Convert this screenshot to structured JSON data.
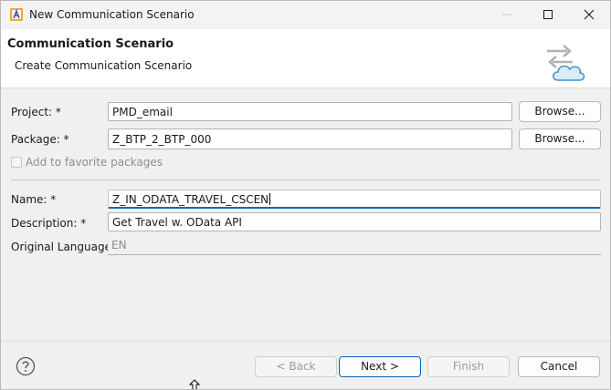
{
  "window": {
    "title": "New Communication Scenario"
  },
  "icons": {
    "app": "eclipse-adt-icon",
    "minimize": "minimize-icon",
    "maximize": "maximize-icon",
    "close": "close-icon",
    "header": "transfer-cloud-icon",
    "help": "help-icon",
    "cursor": "mouse-cursor-icon"
  },
  "header": {
    "title": "Communication Scenario",
    "subtitle": "Create Communication Scenario"
  },
  "form": {
    "project": {
      "label": "Project: *",
      "value": "PMD_email",
      "browse": "Browse..."
    },
    "package": {
      "label": "Package: *",
      "value": "Z_BTP_2_BTP_000",
      "browse": "Browse..."
    },
    "favorite": {
      "label": "Add to favorite packages",
      "checked": false
    },
    "name": {
      "label": "Name: *",
      "value": "Z_IN_ODATA_TRAVEL_CSCEN"
    },
    "description": {
      "label": "Description: *",
      "value": "Get Travel w. OData API"
    },
    "language": {
      "label": "Original Language:",
      "value": "EN"
    }
  },
  "footer": {
    "back": "< Back",
    "next": "Next >",
    "finish": "Finish",
    "cancel": "Cancel"
  },
  "colors": {
    "accent": "#0067c0",
    "background": "#f0f0f0",
    "header": "#ffffff"
  }
}
